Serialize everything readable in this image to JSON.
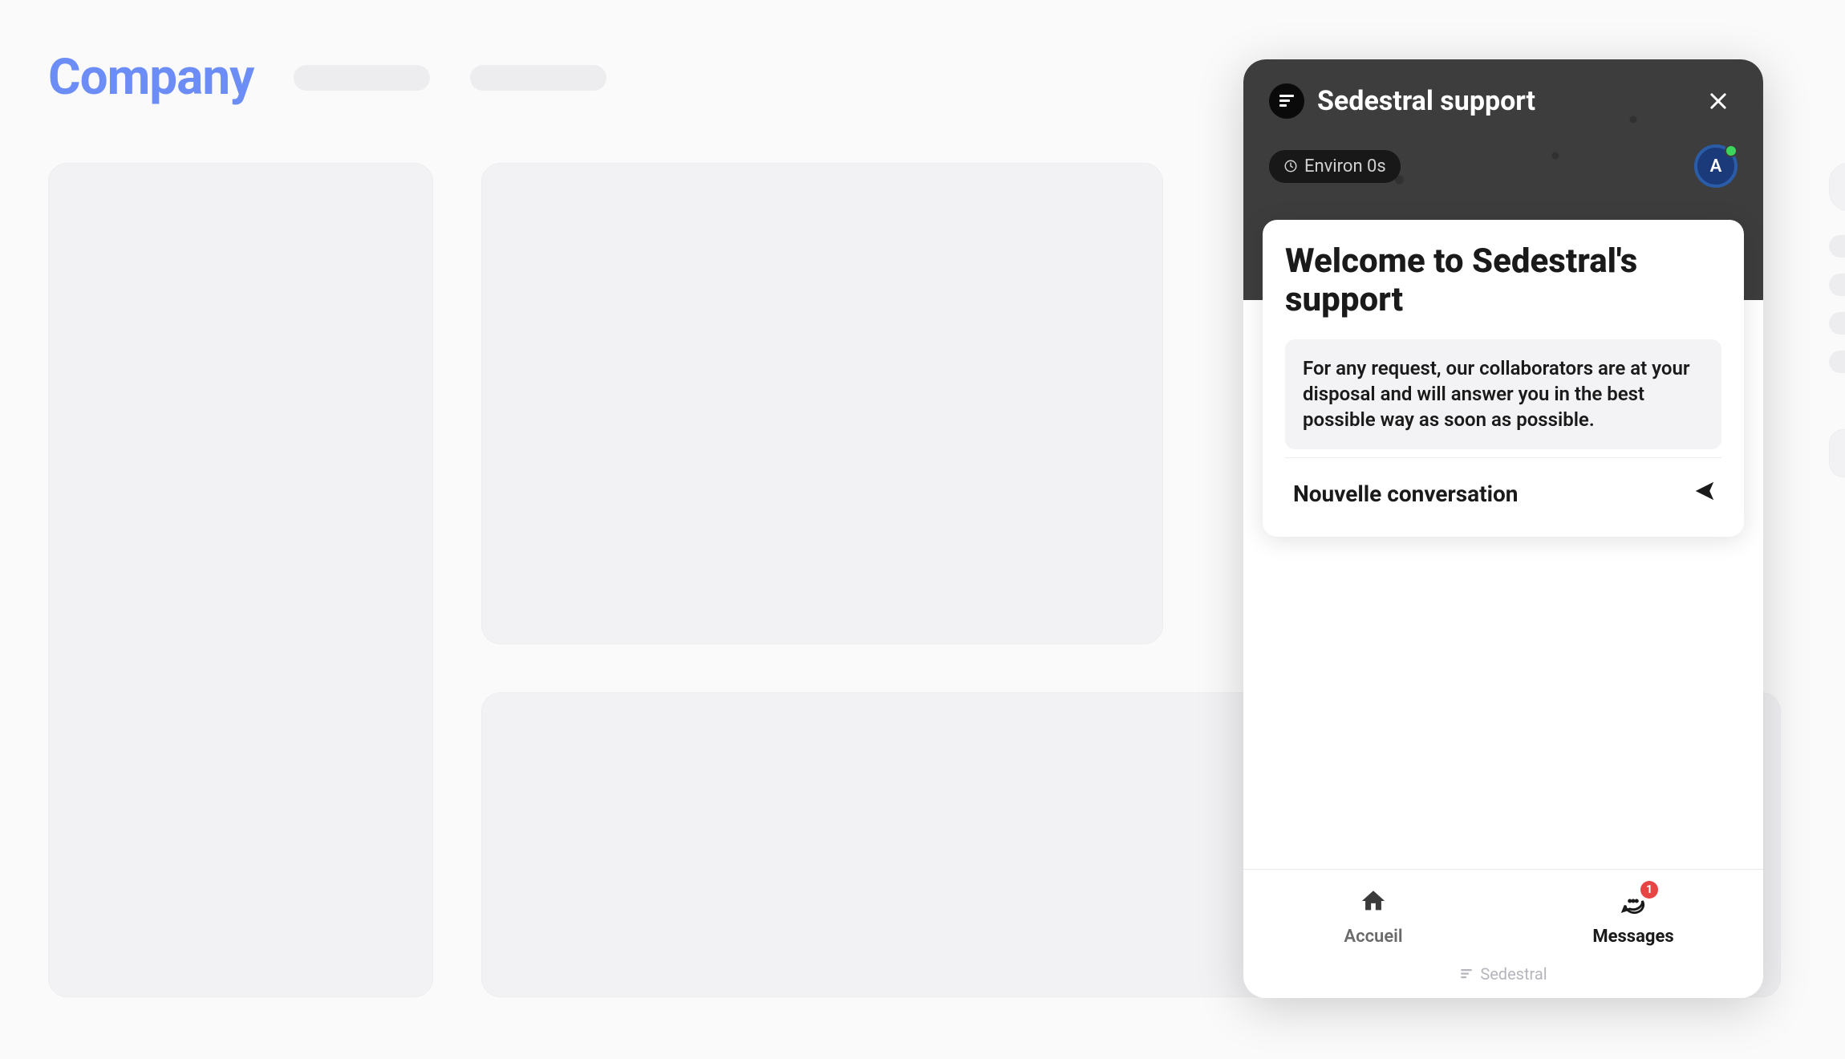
{
  "header": {
    "title": "Company"
  },
  "chat": {
    "brand_title": "Sedestral support",
    "response_time": "Environ 0s",
    "avatar_initial": "A",
    "welcome_title": "Welcome to Sedestral's support",
    "welcome_description": "For any request, our collaborators are at your disposal and will answer you in the best possible way as soon as possible.",
    "new_conversation_label": "Nouvelle conversation",
    "nav": {
      "home_label": "Accueil",
      "messages_label": "Messages",
      "messages_badge": "1"
    },
    "footer_brand": "Sedestral"
  }
}
